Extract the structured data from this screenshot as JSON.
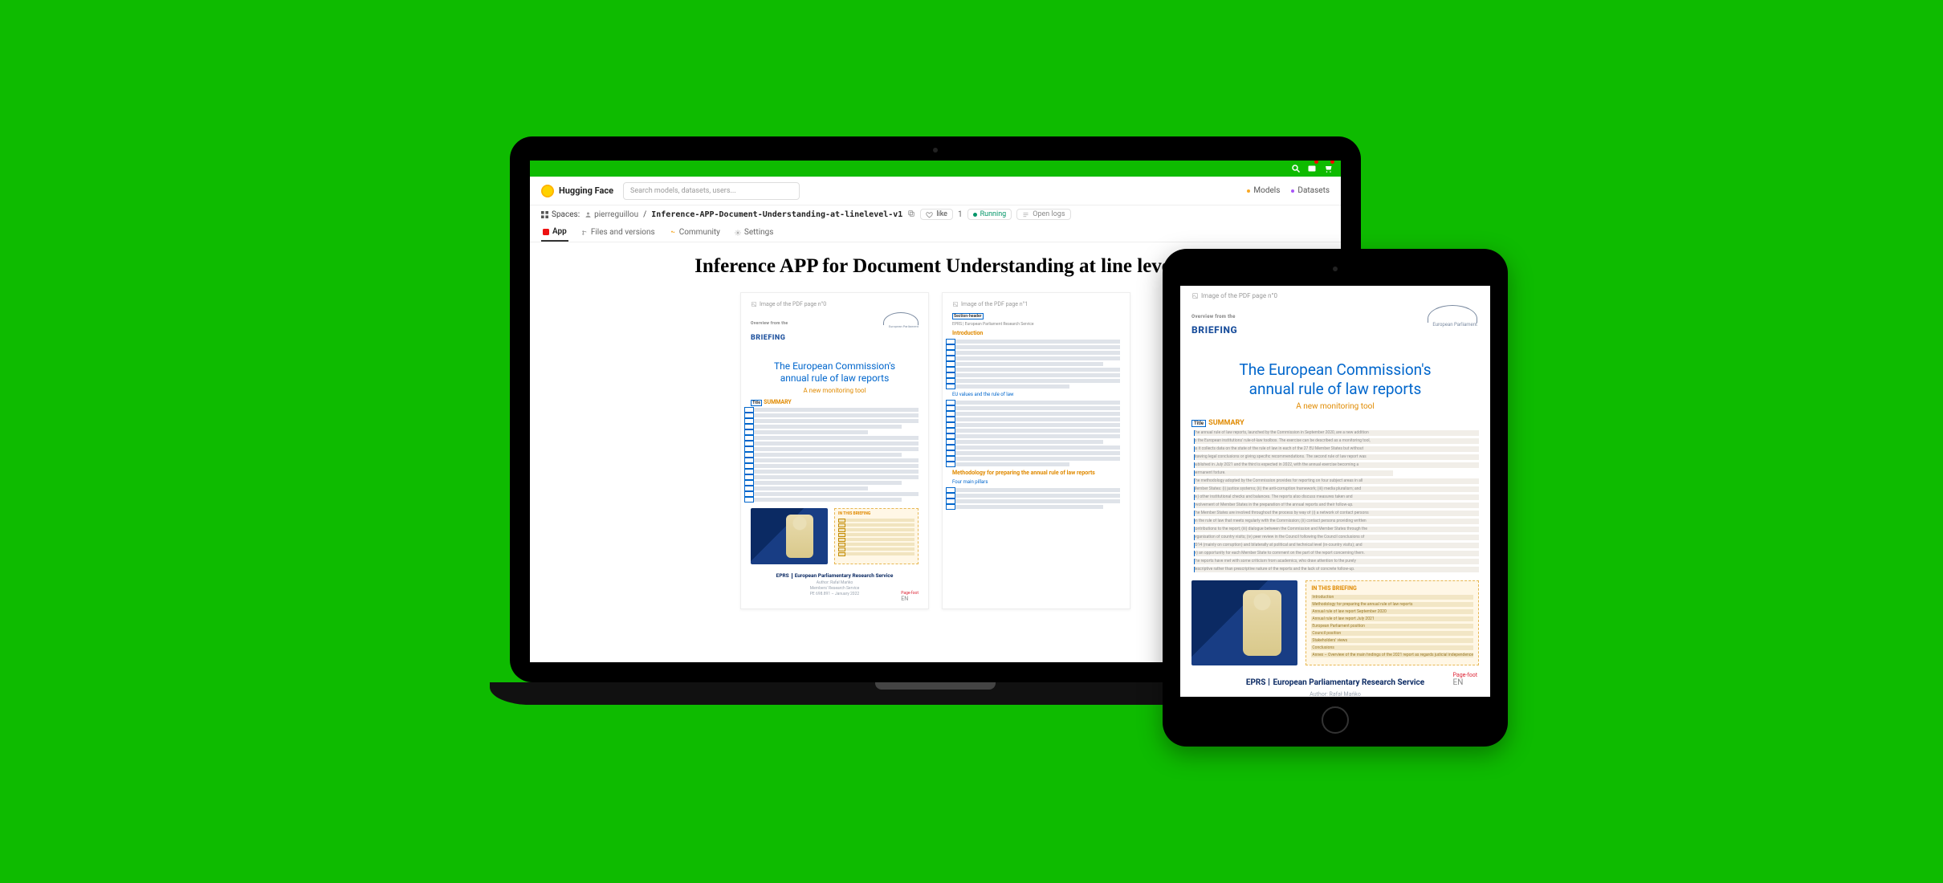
{
  "topbar": {
    "search_icon": "search-icon",
    "mail_icon": "mail-icon",
    "cart_icon": "cart-icon"
  },
  "hf": {
    "brand": "Hugging Face",
    "search_placeholder": "Search models, datasets, users...",
    "nav_models": "Models",
    "nav_datasets": "Datasets"
  },
  "crumb": {
    "spaces": "Spaces:",
    "user": "pierreguillou",
    "repo": "Inference-APP-Document-Understanding-at-linelevel-v1",
    "like": "like",
    "like_count": "1",
    "running": "Running",
    "open_logs": "Open logs"
  },
  "tabs": {
    "app": "App",
    "files": "Files and versions",
    "community": "Community",
    "settings": "Settings"
  },
  "app": {
    "title": "Inference APP for Document Understanding at line level",
    "page0_label": "Image of the PDF page n°0",
    "page1_label": "Image of the PDF page n°1"
  },
  "doc": {
    "briefing_over": "Overview from the",
    "briefing": "BRIEFING",
    "ep_logo_text": "European Parliament",
    "title_l1": "The European Commission's",
    "title_l2": "annual rule of law reports",
    "subtitle": "A new monitoring tool",
    "summary_head": "SUMMARY",
    "summary_tag": "Title",
    "summary_p": [
      "The annual rule of law reports, launched by the Commission in September 2020, are a new addition",
      "to the European institutions' rule-of-law toolbox. The exercise can be described as a monitoring tool,",
      "as it collects data on the state of the rule of law in each of the 27 EU Member States but without",
      "drawing legal conclusions or giving specific recommendations. The second rule of law report was",
      "published in July 2021 and the third is expected in 2022, with the annual exercise becoming a",
      "permanent fixture.",
      "The methodology adopted by the Commission provides for reporting on four subject areas in all",
      "Member States: (i) justice systems; (ii) the anti-corruption framework; (iii) media pluralism; and",
      "(iv) other institutional checks and balances. The reports also discuss measures taken and",
      "involvement of Member States in the preparation of the annual reports and their follow-up.",
      "The Member States are involved throughout the process by way of (i) a network of contact persons",
      "on the rule of law that meets regularly with the Commission; (ii) contact persons providing written",
      "contributions to the report; (iii) dialogue between the Commission and Member States through the",
      "organisation of country visits; (iv) peer review in the Council following the Council conclusions of",
      "2014 (mainly on corruption) and bilaterally at political and technical level (in-country visits); and",
      "(v) an opportunity for each Member State to comment on the part of the report concerning them.",
      "The reports have met with some criticism from academics, who draw attention to the purely",
      "descriptive rather than prescriptive nature of the reports and the lack of concrete follow-up."
    ],
    "inbox_head": "IN THIS BRIEFING",
    "inbox_items": [
      "Introduction",
      "Methodology for preparing the annual rule of law reports",
      "Annual rule of law report September 2020",
      "Annual rule of law report July 2021",
      "European Parliament position",
      "Council position",
      "Stakeholders' views",
      "Conclusions",
      "Annex – Overview of the main findings of the 2021 report as regards judicial independence"
    ],
    "eprs_abbr": "EPRS",
    "eprs_full": "European Parliamentary Research Service",
    "author": "Author: Rafał Mańko",
    "members": "Members' Research Service",
    "ref": "PE 698.891 – January 2022",
    "lang": "EN",
    "page_foot": "Page-foot"
  },
  "doc_p2": {
    "title_small": "EPRS | European Parliament Research Service",
    "section_header": "Section-header",
    "intro": "Introduction",
    "para_count": 12,
    "sub1": "EU values and the rule of law",
    "method": "Methodology for preparing the annual rule of law reports",
    "sub2": "Four main pillars"
  }
}
